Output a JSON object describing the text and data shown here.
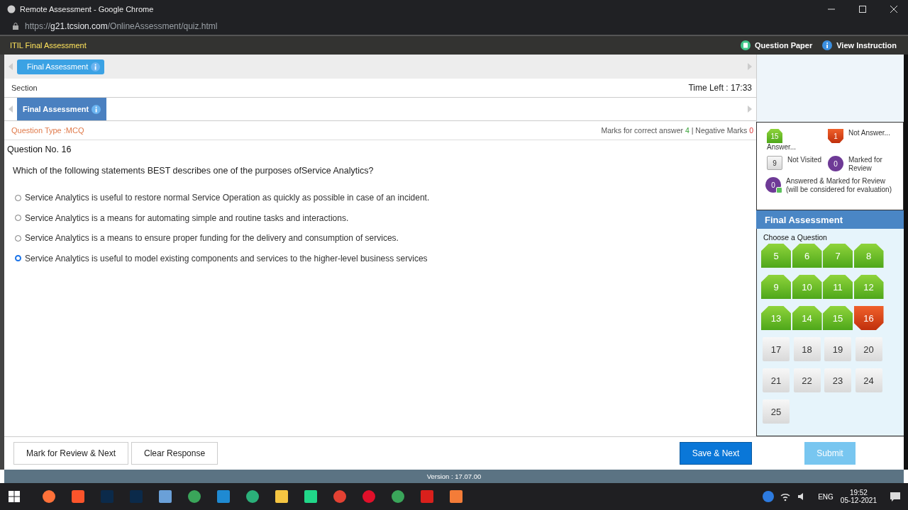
{
  "browser": {
    "title": "Remote Assessment - Google Chrome",
    "url_scheme": "https://",
    "url_host": "g21.tcsion.com",
    "url_path": "/OnlineAssessment/quiz.html"
  },
  "header": {
    "title": "ITIL Final Assessment",
    "links": [
      "Question Paper",
      "View Instruction"
    ]
  },
  "top_tab": {
    "label": "Final Assessment"
  },
  "section_label": "Section",
  "time_left": "Time Left : 17:33",
  "section_tab": {
    "label": "Final Assessment",
    "selected": true
  },
  "question_type": "Question Type :MCQ",
  "marks": {
    "correct_label": "Marks for correct answer",
    "correct": "4",
    "separator": "|",
    "negative_label": "Negative Marks",
    "negative": "0"
  },
  "question_no": "Question No. 16",
  "question": "Which of the following statements BEST describes one of the purposes ofService Analytics?",
  "options": [
    {
      "text": "Service Analytics is useful to restore normal Service Operation as quickly as possible in case of an incident.",
      "selected": false
    },
    {
      "text": "Service Analytics is a means for automating simple and routine tasks and interactions.",
      "selected": false
    },
    {
      "text": "Service Analytics is a means to ensure proper funding for the delivery and consumption of services.",
      "selected": false
    },
    {
      "text": "Service Analytics is useful to model existing components and services to the higher-level business services",
      "selected": true
    }
  ],
  "buttons": {
    "mark_review": "Mark for Review & Next",
    "clear": "Clear Response",
    "save_next": "Save & Next",
    "submit": "Submit"
  },
  "legend": [
    {
      "kind": "answered",
      "count": "15",
      "label": "Answer..."
    },
    {
      "kind": "not_answered",
      "count": "1",
      "label": "Not Answer..."
    },
    {
      "kind": "not_visited",
      "count": "9",
      "label": "Not Visited"
    },
    {
      "kind": "marked",
      "count": "0",
      "label": "Marked for Review"
    },
    {
      "kind": "answered_marked",
      "count": "0",
      "label": "Answered & Marked for Review (will be considered for evaluation)"
    }
  ],
  "palette": {
    "title": "Final Assessment",
    "subtitle": "Choose a Question",
    "questions": [
      {
        "number": "5",
        "kind": "answered"
      },
      {
        "number": "6",
        "kind": "answered"
      },
      {
        "number": "7",
        "kind": "answered"
      },
      {
        "number": "8",
        "kind": "answered"
      },
      {
        "number": "9",
        "kind": "answered"
      },
      {
        "number": "10",
        "kind": "answered"
      },
      {
        "number": "11",
        "kind": "answered"
      },
      {
        "number": "12",
        "kind": "answered"
      },
      {
        "number": "13",
        "kind": "answered"
      },
      {
        "number": "14",
        "kind": "answered"
      },
      {
        "number": "15",
        "kind": "answered"
      },
      {
        "number": "16",
        "kind": "not_answered"
      },
      {
        "number": "17",
        "kind": "not_visited"
      },
      {
        "number": "18",
        "kind": "not_visited"
      },
      {
        "number": "19",
        "kind": "not_visited"
      },
      {
        "number": "20",
        "kind": "not_visited"
      },
      {
        "number": "21",
        "kind": "not_visited"
      },
      {
        "number": "22",
        "kind": "not_visited"
      },
      {
        "number": "23",
        "kind": "not_visited"
      },
      {
        "number": "24",
        "kind": "not_visited"
      },
      {
        "number": "25",
        "kind": "not_visited"
      }
    ]
  },
  "version": "Version : 17.07.00",
  "taskbar": {
    "language": "ENG",
    "time": "19:52",
    "date": "05-12-2021"
  }
}
